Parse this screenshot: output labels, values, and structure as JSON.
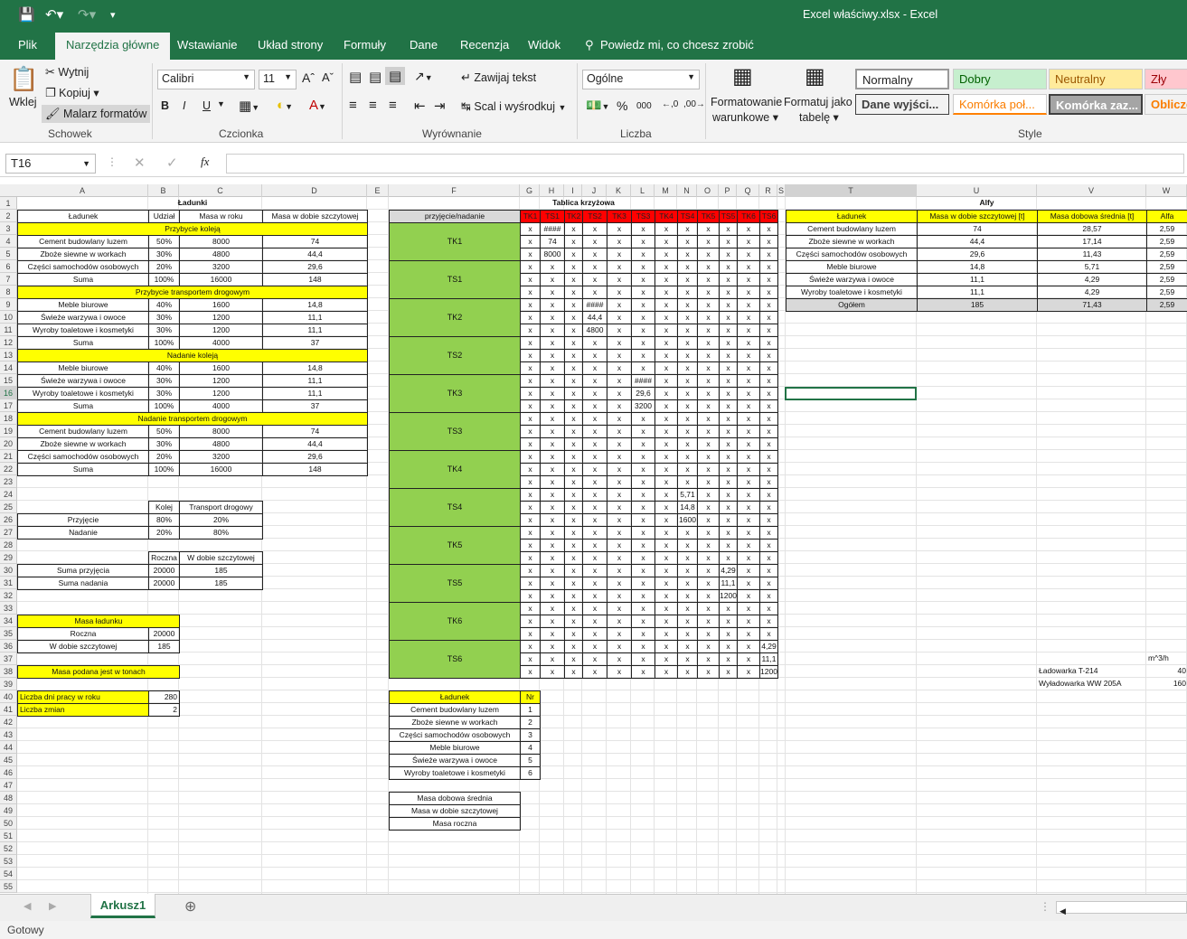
{
  "window": {
    "title": "Excel właściwy.xlsx  -  Excel"
  },
  "ribbon_tabs": [
    "Plik",
    "Narzędzia główne",
    "Wstawianie",
    "Układ strony",
    "Formuły",
    "Dane",
    "Recenzja",
    "Widok"
  ],
  "tell_me": "Powiedz mi, co chcesz zrobić",
  "clipboard": {
    "paste": "Wklej",
    "cut": "Wytnij",
    "copy": "Kopiuj",
    "painter": "Malarz formatów",
    "group": "Schowek"
  },
  "font": {
    "name": "Calibri",
    "size": "11",
    "group": "Czcionka",
    "bold": "B",
    "italic": "I",
    "underline": "U"
  },
  "alignment": {
    "wrap": "Zawijaj tekst",
    "merge": "Scal i wyśrodkuj",
    "group": "Wyrównanie"
  },
  "number": {
    "format": "Ogólne",
    "percent": "%",
    "thousands": "000",
    "group": "Liczba"
  },
  "styles_btns": {
    "cond1": "Formatowanie",
    "cond2": "warunkowe",
    "table1": "Formatuj jako",
    "table2": "tabelę",
    "group": "Style"
  },
  "styles": [
    "Normalny",
    "Dobry",
    "Neutralny",
    "Zły",
    "Dane wyjści...",
    "Komórka poł...",
    "Komórka zaz...",
    "Oblicze"
  ],
  "namebox": "T16",
  "fx": "fx",
  "sheet_tab": "Arkusz1",
  "status": "Gotowy",
  "columns": [
    [
      "A",
      ""
    ],
    [
      "B",
      ""
    ],
    [
      "C",
      ""
    ],
    [
      "D",
      ""
    ],
    [
      "E",
      ""
    ],
    [
      "F",
      ""
    ],
    [
      "G",
      ""
    ],
    [
      "H",
      ""
    ],
    [
      "I",
      ""
    ],
    [
      "J",
      ""
    ],
    [
      "K",
      ""
    ],
    [
      "L",
      ""
    ],
    [
      "M",
      ""
    ],
    [
      "N",
      ""
    ],
    [
      "O",
      ""
    ],
    [
      "P",
      ""
    ],
    [
      "Q",
      ""
    ],
    [
      "R",
      ""
    ],
    [
      "S",
      ""
    ],
    [
      "T",
      ""
    ],
    [
      "U",
      ""
    ],
    [
      "V",
      ""
    ],
    [
      "W",
      ""
    ]
  ],
  "left": {
    "title": "Ładunki",
    "hdr": [
      "Ładunek",
      "Udział",
      "Masa w roku",
      "Masa w dobie szczytowej"
    ],
    "sections": [
      {
        "name": "Przybycie koleją",
        "rows": [
          [
            "Cement budowlany luzem",
            "50%",
            "8000",
            "74"
          ],
          [
            "Zboże siewne w workach",
            "30%",
            "4800",
            "44,4"
          ],
          [
            "Części samochodów osobowych",
            "20%",
            "3200",
            "29,6"
          ],
          [
            "Suma",
            "100%",
            "16000",
            "148"
          ]
        ]
      },
      {
        "name": "Przybycie transportem drogowym",
        "rows": [
          [
            "Meble biurowe",
            "40%",
            "1600",
            "14,8"
          ],
          [
            "Świeże warzywa i owoce",
            "30%",
            "1200",
            "11,1"
          ],
          [
            "Wyroby toaletowe i kosmetyki",
            "30%",
            "1200",
            "11,1"
          ],
          [
            "Suma",
            "100%",
            "4000",
            "37"
          ]
        ]
      },
      {
        "name": "Nadanie koleją",
        "rows": [
          [
            "Meble biurowe",
            "40%",
            "1600",
            "14,8"
          ],
          [
            "Świeże warzywa i owoce",
            "30%",
            "1200",
            "11,1"
          ],
          [
            "Wyroby toaletowe i kosmetyki",
            "30%",
            "1200",
            "11,1"
          ],
          [
            "Suma",
            "100%",
            "4000",
            "37"
          ]
        ]
      },
      {
        "name": "Nadanie transportem drogowym",
        "rows": [
          [
            "Cement budowlany luzem",
            "50%",
            "8000",
            "74"
          ],
          [
            "Zboże siewne w workach",
            "30%",
            "4800",
            "44,4"
          ],
          [
            "Części samochodów osobowych",
            "20%",
            "3200",
            "29,6"
          ],
          [
            "Suma",
            "100%",
            "16000",
            "148"
          ]
        ]
      }
    ],
    "split_hdr": [
      "Kolej",
      "Transport drogowy"
    ],
    "split": [
      [
        "Przyjęcie",
        "80%",
        "20%"
      ],
      [
        "Nadanie",
        "20%",
        "80%"
      ]
    ],
    "sum_hdr": [
      "Roczna",
      "W dobie szczytowej"
    ],
    "sums": [
      [
        "Suma przyjęcia",
        "20000",
        "185"
      ],
      [
        "Suma nadania",
        "20000",
        "185"
      ]
    ],
    "masa_title": "Masa ładunku",
    "masa": [
      [
        "Roczna",
        "20000"
      ],
      [
        "W dobie szczytowej",
        "185"
      ]
    ],
    "note": "Masa podana jest w tonach",
    "params": [
      [
        "Liczba dni pracy w roku",
        "280"
      ],
      [
        "Liczba zmian",
        "2"
      ]
    ]
  },
  "cross": {
    "title": "Tablica krzyżowa",
    "corner": "przyjęcie/nadanie",
    "cols": [
      "TK1",
      "TS1",
      "TK2",
      "TS2",
      "TK3",
      "TS3",
      "TK4",
      "TS4",
      "TK5",
      "TS5",
      "TK6",
      "TS6"
    ],
    "rows": [
      "TK1",
      "TS1",
      "TK2",
      "TS2",
      "TK3",
      "TS3",
      "TK4",
      "TS4",
      "TK5",
      "TS5",
      "TK6",
      "TS6"
    ]
  },
  "legend": {
    "hdr": [
      "Ładunek",
      "Nr"
    ],
    "rows": [
      [
        "Cement budowlany luzem",
        "1"
      ],
      [
        "Zboże siewne w workach",
        "2"
      ],
      [
        "Części samochodów osobowych",
        "3"
      ],
      [
        "Meble biurowe",
        "4"
      ],
      [
        "Świeże warzywa i owoce",
        "5"
      ],
      [
        "Wyroby toaletowe i kosmetyki",
        "6"
      ]
    ],
    "masses": [
      "Masa dobowa średnia",
      "Masa w dobie szczytowej",
      "Masa roczna"
    ]
  },
  "alfy": {
    "title": "Alfy",
    "hdr": [
      "Ładunek",
      "Masa w dobie szczytowej [t]",
      "Masa dobowa średnia [t]",
      "Alfa"
    ],
    "rows": [
      [
        "Cement budowlany luzem",
        "74",
        "28,57",
        "2,59"
      ],
      [
        "Zboże siewne w workach",
        "44,4",
        "17,14",
        "2,59"
      ],
      [
        "Części samochodów osobowych",
        "29,6",
        "11,43",
        "2,59"
      ],
      [
        "Meble biurowe",
        "14,8",
        "5,71",
        "2,59"
      ],
      [
        "Świeże warzywa i owoce",
        "11,1",
        "4,29",
        "2,59"
      ],
      [
        "Wyroby toaletowe i kosmetyki",
        "11,1",
        "4,29",
        "2,59"
      ],
      [
        "Ogółem",
        "185",
        "71,43",
        "2,59"
      ]
    ],
    "unit": "m^3/h",
    "machines": [
      [
        "Ładowarka T-214",
        "40"
      ],
      [
        "Wyładowarka WW 205A",
        "160"
      ]
    ]
  }
}
